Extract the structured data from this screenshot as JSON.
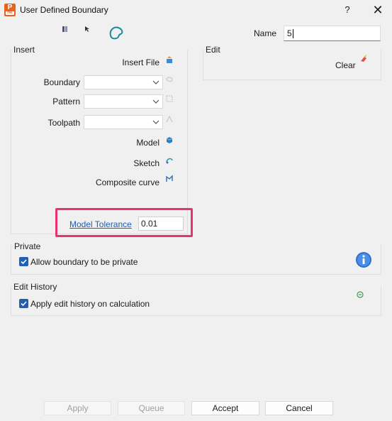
{
  "window": {
    "title": "User Defined Boundary",
    "help": "?",
    "close": "✕",
    "app_icon_letter": "P",
    "app_icon_sub": "HR"
  },
  "header": {
    "name_label": "Name",
    "name_value": "5"
  },
  "insert": {
    "label": "Insert",
    "insert_file": "Insert File",
    "boundary_label": "Boundary",
    "pattern_label": "Pattern",
    "toolpath_label": "Toolpath",
    "model": "Model",
    "sketch": "Sketch",
    "composite_curve": "Composite curve",
    "tolerance_link": "Model Tolerance",
    "tolerance_value": "0.01"
  },
  "edit": {
    "label": "Edit",
    "clear": "Clear"
  },
  "private": {
    "label": "Private",
    "checkbox_label": "Allow boundary to be private",
    "checked": true
  },
  "edit_history": {
    "label": "Edit History",
    "checkbox_label": "Apply edit history on calculation",
    "checked": true
  },
  "footer": {
    "apply": "Apply",
    "queue": "Queue",
    "accept": "Accept",
    "cancel": "Cancel"
  },
  "colors": {
    "highlight": "#e8336e",
    "link": "#1a5fb4",
    "checkbox": "#1f5fb4",
    "info": "#2f6fcf"
  }
}
